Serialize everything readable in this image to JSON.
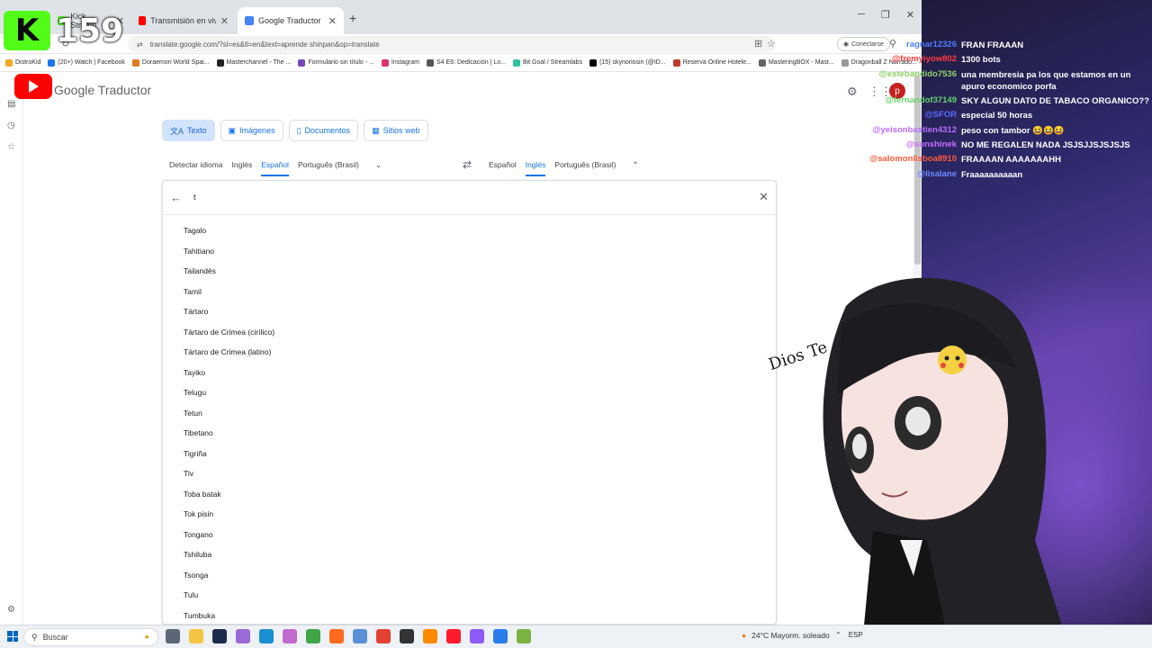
{
  "browser": {
    "tabs": [
      {
        "title": "Kick Stream",
        "color": "#53fc18"
      },
      {
        "title": "Transmisión en vivo - YouTube",
        "color": "#ff0000"
      },
      {
        "title": "Google Traductor",
        "color": "#4285f4"
      }
    ],
    "url": "translate.google.com/?sl=es&tl=en&text=aprende shinpan&op=translate",
    "connect_label": "Conectarse",
    "bookmarks": [
      "DistroKid",
      "(20+) Watch | Facebook",
      "Doraemon World Spai...",
      "Masterchannel - The ...",
      "Formulario sin título - ...",
      "Instagram",
      "S4 E6: Dedicación | Lo...",
      "Bit Goal / Streamlabs",
      "(15) skynoriosin (@ID...",
      "Reserva Online Hotele...",
      "MasteringBOX - Mast...",
      "Dragonball Z Narrado..."
    ]
  },
  "translate": {
    "logo": "Google Traductor",
    "avatar_initial": "p",
    "modes": [
      "Texto",
      "Imágenes",
      "Documentos",
      "Sitios web"
    ],
    "source_langs": [
      "Detectar idioma",
      "Inglés",
      "Español",
      "Português (Brasil)"
    ],
    "target_langs": [
      "Español",
      "Inglés",
      "Português (Brasil)"
    ],
    "search_query": "t",
    "languages": [
      "Tagalo",
      "Tahitiano",
      "Tailandés",
      "Tamil",
      "Tártaro",
      "Tártaro de Crimea (cirílico)",
      "Tártaro de Crimea (latino)",
      "Tayiko",
      "Telugu",
      "Tetun",
      "Tibetano",
      "Tigriña",
      "Tiv",
      "Toba batak",
      "Tok pisin",
      "Tongano",
      "Tshiluba",
      "Tsonga",
      "Tulu",
      "Tumbuka"
    ]
  },
  "overlay": {
    "kick_count": "159",
    "chat": [
      {
        "user": "ragnar12326",
        "color": "#4f7cff",
        "text": "FRAN FRAAAN"
      },
      {
        "user": "@fremyiyow802",
        "color": "#ff3b3b",
        "text": "1300 bots"
      },
      {
        "user": "@estebandido7536",
        "color": "#8fd16a",
        "text": "una membresia pa los que estamos en un apuro economico porfa"
      },
      {
        "user": "@fernandof37149",
        "color": "#66d46a",
        "text": "SKY ALGUN DATO DE TABACO ORGANICO??"
      },
      {
        "user": "@SFOR",
        "color": "#5a6bff",
        "text": "especial 50 horas"
      },
      {
        "user": "@yeisonbastien4312",
        "color": "#b86cff",
        "text": "peso con tambor 😆😆😆"
      },
      {
        "user": "@sunshinek",
        "color": "#c86cff",
        "text": "NO ME REGALEN NADA JSJSJJSJSJSJS"
      },
      {
        "user": "@salomonlisboa8910",
        "color": "#ff5a3b",
        "text": "FRAAAAN AAAAAAAHH"
      },
      {
        "user": "@lisalane",
        "color": "#6c8cff",
        "text": "Fraaaaaaaaaan"
      }
    ],
    "dios_text": "Dios Te Ama"
  },
  "taskbar": {
    "search_placeholder": "Buscar",
    "weather": "24°C  Mayorm. soleado",
    "lang": "ESP"
  }
}
